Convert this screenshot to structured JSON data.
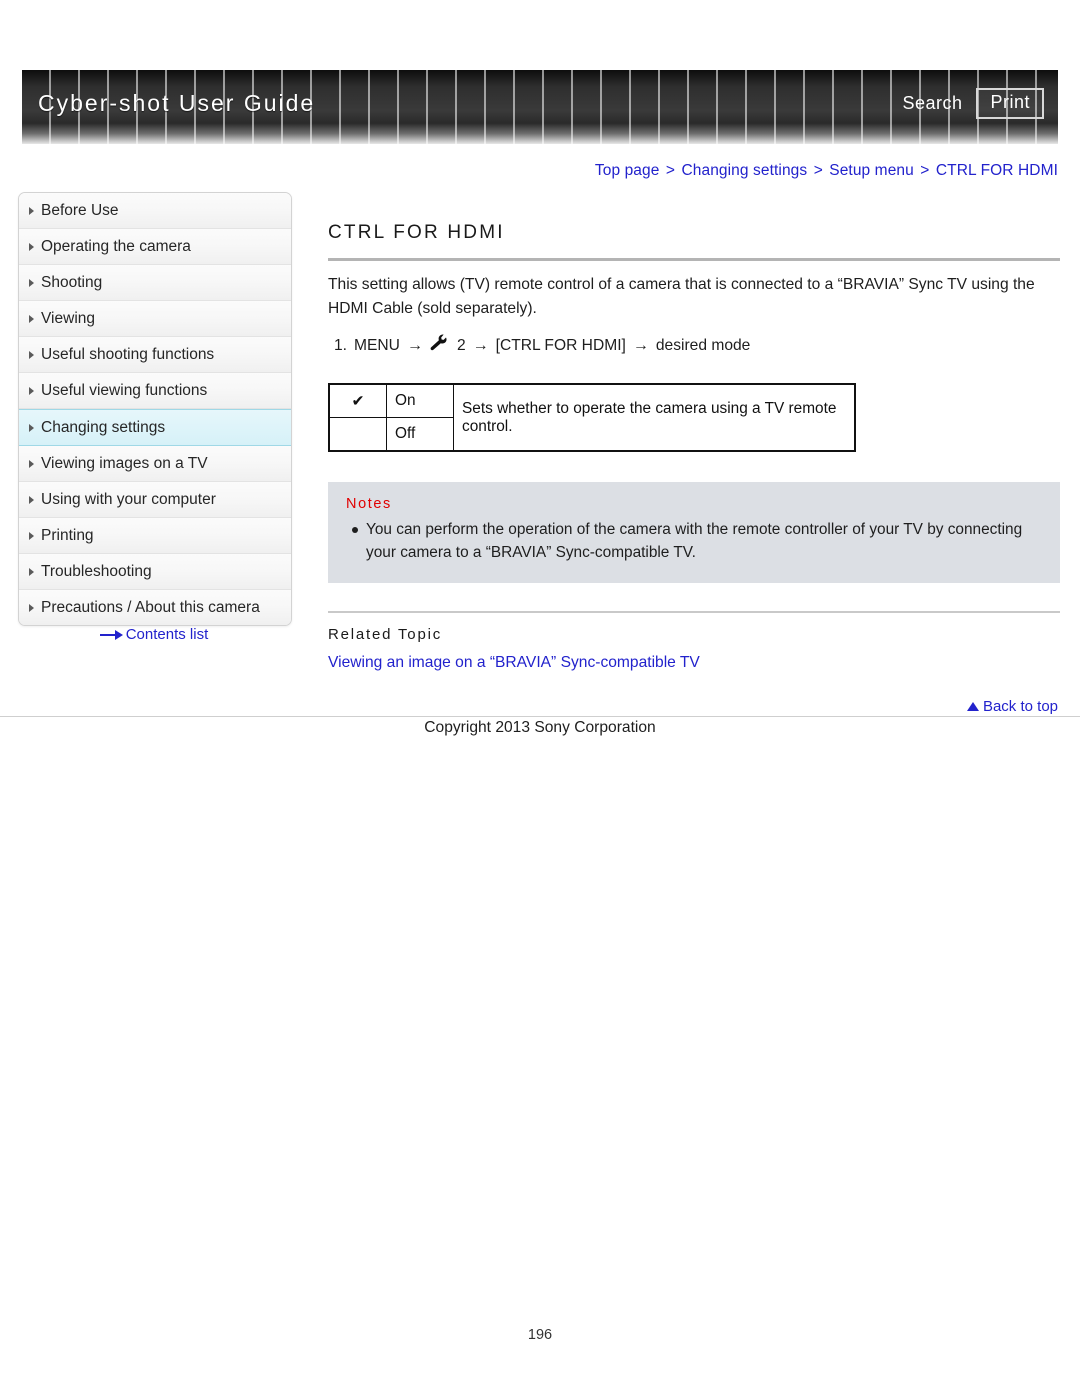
{
  "header": {
    "title": "Cyber-shot User Guide",
    "search_label": "Search",
    "print_label": "Print"
  },
  "breadcrumb": {
    "items": [
      "Top page",
      "Changing settings",
      "Setup menu",
      "CTRL FOR HDMI"
    ],
    "separator": ">",
    "color": "#2222cc"
  },
  "sidebar": {
    "items": [
      {
        "label": "Before Use",
        "active": false
      },
      {
        "label": "Operating the camera",
        "active": false
      },
      {
        "label": "Shooting",
        "active": false
      },
      {
        "label": "Viewing",
        "active": false
      },
      {
        "label": "Useful shooting functions",
        "active": false
      },
      {
        "label": "Useful viewing functions",
        "active": false
      },
      {
        "label": "Changing settings",
        "active": true
      },
      {
        "label": "Viewing images on a TV",
        "active": false
      },
      {
        "label": "Using with your computer",
        "active": false
      },
      {
        "label": "Printing",
        "active": false
      },
      {
        "label": "Troubleshooting",
        "active": false
      },
      {
        "label": "Precautions / About this camera",
        "active": false
      }
    ],
    "contents_list_label": "Contents list",
    "active_highlight_color": "#d6f1f8"
  },
  "main": {
    "title": "CTRL FOR HDMI",
    "intro": "This setting allows (TV) remote control of a camera that is connected to a “BRAVIA” Sync TV using the HDMI Cable (sold separately).",
    "step": {
      "number": "1.",
      "part1": "MENU",
      "arrow1": "→",
      "menu_icon_label": "setup-menu-wrench-icon",
      "menu_number": "2",
      "arrow2": "→",
      "part2": "[CTRL FOR HDMI]",
      "arrow3": "→",
      "part3": "desired mode"
    },
    "options_table": {
      "rows": [
        {
          "check": "✔",
          "label": "On",
          "selected": true
        },
        {
          "check": "",
          "label": "Off",
          "selected": false
        }
      ],
      "description": "Sets whether to operate the camera using a TV remote control."
    },
    "notes": {
      "title": "Notes",
      "title_color": "#e10000",
      "background": "#dcdfe4",
      "items": [
        "You can perform the operation of the camera with the remote controller of your TV by connecting your camera to a “BRAVIA” Sync-compatible TV."
      ]
    },
    "related": {
      "title": "Related Topic",
      "links": [
        "Viewing an image on a “BRAVIA” Sync-compatible TV"
      ]
    }
  },
  "footer": {
    "back_to_top_label": "Back to top",
    "copyright": "Copyright 2013 Sony Corporation",
    "page_number": "196"
  }
}
